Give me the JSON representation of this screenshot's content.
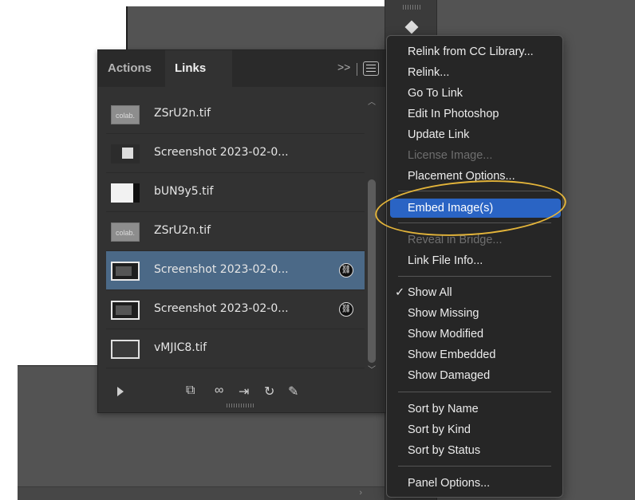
{
  "panel": {
    "tabs": [
      {
        "label": "Actions",
        "active": false
      },
      {
        "label": "Links",
        "active": true
      }
    ],
    "overflow_label": ">>",
    "links": [
      {
        "name": "ZSrU2n.tif",
        "thumb": "colab-thumbnail",
        "thumb_text": "colab.",
        "selected": false,
        "embedded": false
      },
      {
        "name": "Screenshot 2023-02-0...",
        "thumb": "screenshot-thumbnail",
        "selected": false,
        "embedded": false
      },
      {
        "name": "bUN9y5.tif",
        "thumb": "image-thumbnail",
        "selected": false,
        "embedded": false
      },
      {
        "name": "ZSrU2n.tif",
        "thumb": "colab-thumbnail",
        "thumb_text": "colab.",
        "selected": false,
        "embedded": false
      },
      {
        "name": "Screenshot 2023-02-0...",
        "thumb": "screenshot-thumbnail",
        "selected": true,
        "embedded": true
      },
      {
        "name": "Screenshot 2023-02-0...",
        "thumb": "screenshot-thumbnail",
        "selected": false,
        "embedded": true
      },
      {
        "name": "vMJIC8.tif",
        "thumb": "image-thumbnail",
        "selected": false,
        "embedded": false
      }
    ],
    "toolbar_icons": [
      "play-icon",
      "relink-from-cc-icon",
      "relink-icon",
      "go-to-link-icon",
      "update-link-icon",
      "edit-original-icon"
    ]
  },
  "menu": {
    "items": [
      {
        "label": "Relink from CC Library...",
        "disabled": false
      },
      {
        "label": "Relink...",
        "disabled": false
      },
      {
        "label": "Go To Link",
        "disabled": false
      },
      {
        "label": "Edit In Photoshop",
        "disabled": false
      },
      {
        "label": "Update Link",
        "disabled": false
      },
      {
        "label": "License Image...",
        "disabled": true
      },
      {
        "label": "Placement Options...",
        "disabled": false
      },
      {
        "label": "Embed Image(s)",
        "disabled": false,
        "highlighted": true
      },
      {
        "label": "Reveal in Bridge...",
        "disabled": true
      },
      {
        "label": "Link File Info...",
        "disabled": false
      },
      {
        "label": "Show All",
        "disabled": false,
        "checked": true
      },
      {
        "label": "Show Missing",
        "disabled": false
      },
      {
        "label": "Show Modified",
        "disabled": false
      },
      {
        "label": "Show Embedded",
        "disabled": false
      },
      {
        "label": "Show Damaged",
        "disabled": false
      },
      {
        "label": "Sort by Name",
        "disabled": false
      },
      {
        "label": "Sort by Kind",
        "disabled": false
      },
      {
        "label": "Sort by Status",
        "disabled": false
      },
      {
        "label": "Panel Options...",
        "disabled": false
      }
    ],
    "check_glyph": "✓"
  },
  "colors": {
    "selection": "#4b6987",
    "menu_highlight": "#2a64c4",
    "annotation": "#e3b43a"
  }
}
